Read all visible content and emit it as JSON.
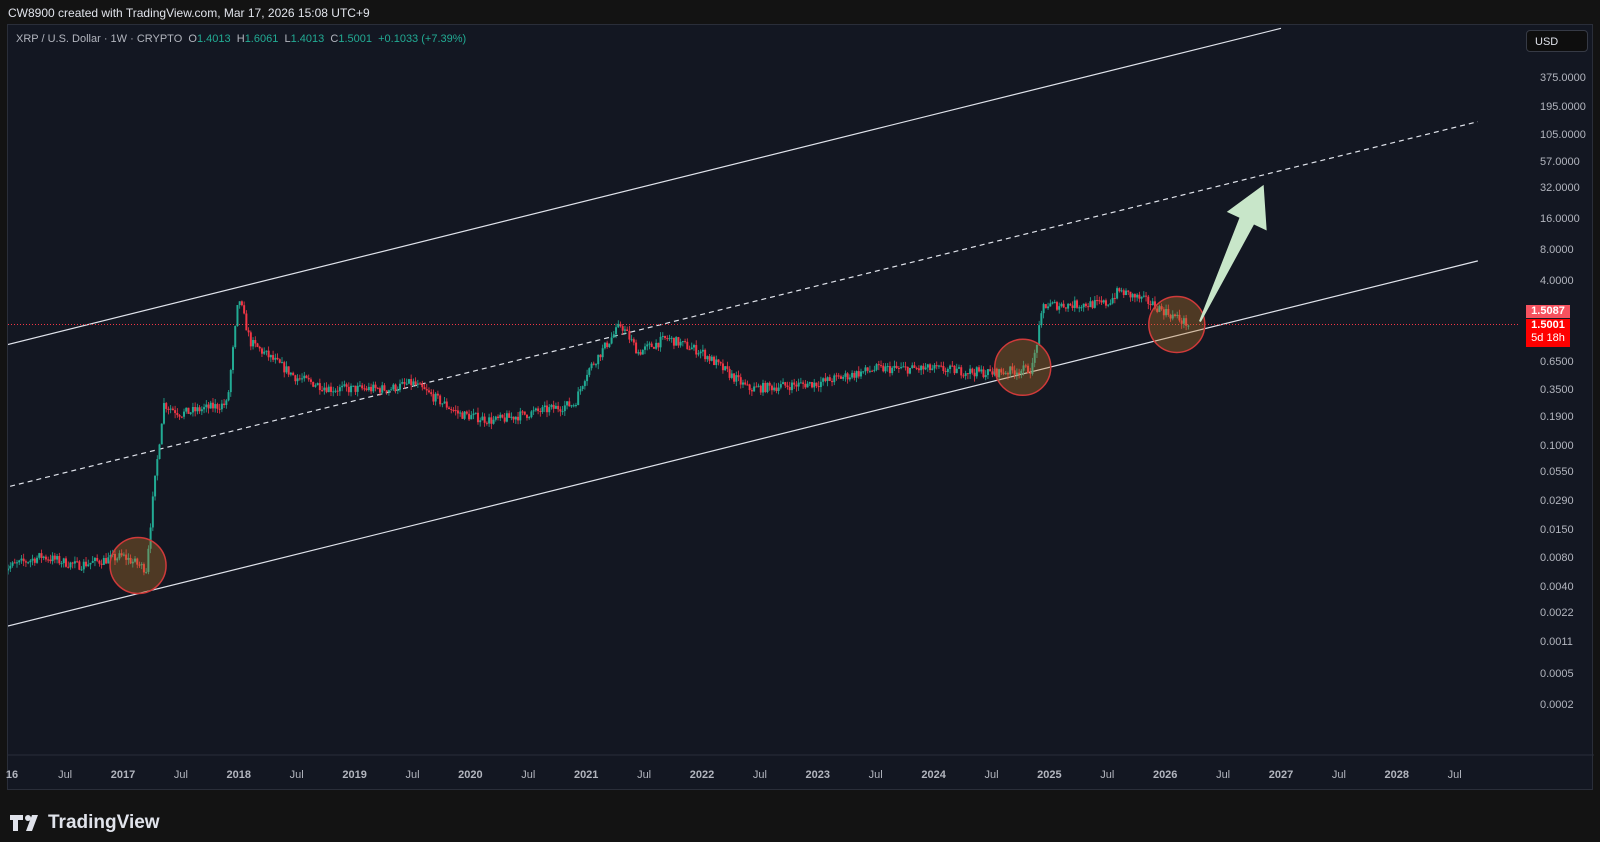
{
  "credit": "CW8900 created with TradingView.com, Mar 17, 2026 15:08 UTC+9",
  "legend": {
    "symbol": "XRP / U.S. Dollar · 1W · CRYPTO",
    "o_label": "O",
    "o": "1.4013",
    "h_label": "H",
    "h": "1.6061",
    "l_label": "L",
    "l": "1.4013",
    "c_label": "C",
    "c": "1.5001",
    "change": "+0.1033 (+7.39%)"
  },
  "currency_button": "USD",
  "price_labels": {
    "high": "1.5087",
    "last": "1.5001",
    "countdown": "5d 18h"
  },
  "brand": "TradingView",
  "colors": {
    "up": "#22ab94",
    "down": "#f23645",
    "bg": "#131722",
    "arrow": "#c8e6c9",
    "circle": "#f23645"
  },
  "chart_data": {
    "type": "candlestick",
    "title": "XRP / U.S. Dollar · 1W · CRYPTO",
    "yscale": "log",
    "y_ticks": [
      "375.0000",
      "195.0000",
      "105.0000",
      "57.0000",
      "32.0000",
      "16.0000",
      "8.0000",
      "4.0000",
      "0.6500",
      "0.3500",
      "0.1900",
      "0.1000",
      "0.0550",
      "0.0290",
      "0.0150",
      "0.0080",
      "0.0040",
      "0.0022",
      "0.0011",
      "0.0005",
      "0.0002"
    ],
    "y_tick_values": [
      375,
      195,
      105,
      57,
      32,
      16,
      8,
      4,
      0.65,
      0.35,
      0.19,
      0.1,
      0.055,
      0.029,
      0.015,
      0.008,
      0.004,
      0.0022,
      0.0011,
      0.0005,
      0.0002
    ],
    "x_ticks": [
      {
        "label": "16",
        "t": 2016.0,
        "major": true
      },
      {
        "label": "Jul",
        "t": 2016.5
      },
      {
        "label": "2017",
        "t": 2017,
        "major": true
      },
      {
        "label": "Jul",
        "t": 2017.5
      },
      {
        "label": "2018",
        "t": 2018,
        "major": true
      },
      {
        "label": "Jul",
        "t": 2018.5
      },
      {
        "label": "2019",
        "t": 2019,
        "major": true
      },
      {
        "label": "Jul",
        "t": 2019.5
      },
      {
        "label": "2020",
        "t": 2020,
        "major": true
      },
      {
        "label": "Jul",
        "t": 2020.5
      },
      {
        "label": "2021",
        "t": 2021,
        "major": true
      },
      {
        "label": "Jul",
        "t": 2021.5
      },
      {
        "label": "2022",
        "t": 2022,
        "major": true
      },
      {
        "label": "Jul",
        "t": 2022.5
      },
      {
        "label": "2023",
        "t": 2023,
        "major": true
      },
      {
        "label": "Jul",
        "t": 2023.5
      },
      {
        "label": "2024",
        "t": 2024,
        "major": true
      },
      {
        "label": "Jul",
        "t": 2024.5
      },
      {
        "label": "2025",
        "t": 2025,
        "major": true
      },
      {
        "label": "Jul",
        "t": 2025.5
      },
      {
        "label": "2026",
        "t": 2026,
        "major": true
      },
      {
        "label": "Jul",
        "t": 2026.5
      },
      {
        "label": "2027",
        "t": 2027,
        "major": true
      },
      {
        "label": "Jul",
        "t": 2027.5
      },
      {
        "label": "2028",
        "t": 2028,
        "major": true
      },
      {
        "label": "Jul",
        "t": 2028.5
      }
    ],
    "price_path": [
      [
        2015.95,
        0.006
      ],
      [
        2016.3,
        0.008
      ],
      [
        2016.6,
        0.0065
      ],
      [
        2017.0,
        0.008
      ],
      [
        2017.2,
        0.006
      ],
      [
        2017.26,
        0.03
      ],
      [
        2017.35,
        0.25
      ],
      [
        2017.5,
        0.2
      ],
      [
        2017.9,
        0.25
      ],
      [
        2018.0,
        2.8
      ],
      [
        2018.1,
        1.0
      ],
      [
        2018.5,
        0.45
      ],
      [
        2018.8,
        0.35
      ],
      [
        2019.3,
        0.35
      ],
      [
        2019.5,
        0.4
      ],
      [
        2019.9,
        0.2
      ],
      [
        2020.2,
        0.17
      ],
      [
        2020.9,
        0.25
      ],
      [
        2021.0,
        0.5
      ],
      [
        2021.3,
        1.5
      ],
      [
        2021.45,
        0.8
      ],
      [
        2021.7,
        1.1
      ],
      [
        2022.0,
        0.8
      ],
      [
        2022.4,
        0.35
      ],
      [
        2023.0,
        0.4
      ],
      [
        2023.5,
        0.55
      ],
      [
        2024.0,
        0.55
      ],
      [
        2024.5,
        0.5
      ],
      [
        2024.85,
        0.55
      ],
      [
        2024.95,
        2.3
      ],
      [
        2025.5,
        2.4
      ],
      [
        2025.6,
        3.2
      ],
      [
        2025.85,
        2.5
      ],
      [
        2026.2,
        1.5
      ]
    ],
    "last_price": 1.5001,
    "annotations": [
      {
        "type": "channel_upper",
        "from": [
          2015.95,
          0.92
        ],
        "to": [
          2027.0,
          1200
        ]
      },
      {
        "type": "channel_mid_dashed",
        "from": [
          2015.95,
          0.037
        ],
        "to": [
          2028.7,
          146
        ]
      },
      {
        "type": "channel_lower",
        "from": [
          2015.95,
          0.0016
        ],
        "to": [
          2028.7,
          6.3
        ]
      },
      {
        "type": "circle",
        "at": [
          2017.13,
          0.0065
        ]
      },
      {
        "type": "circle",
        "at": [
          2024.77,
          0.57
        ]
      },
      {
        "type": "circle",
        "at": [
          2026.1,
          1.5
        ]
      },
      {
        "type": "arrow_up",
        "from": [
          2026.3,
          1.6
        ],
        "to": [
          2026.85,
          35
        ]
      }
    ]
  }
}
